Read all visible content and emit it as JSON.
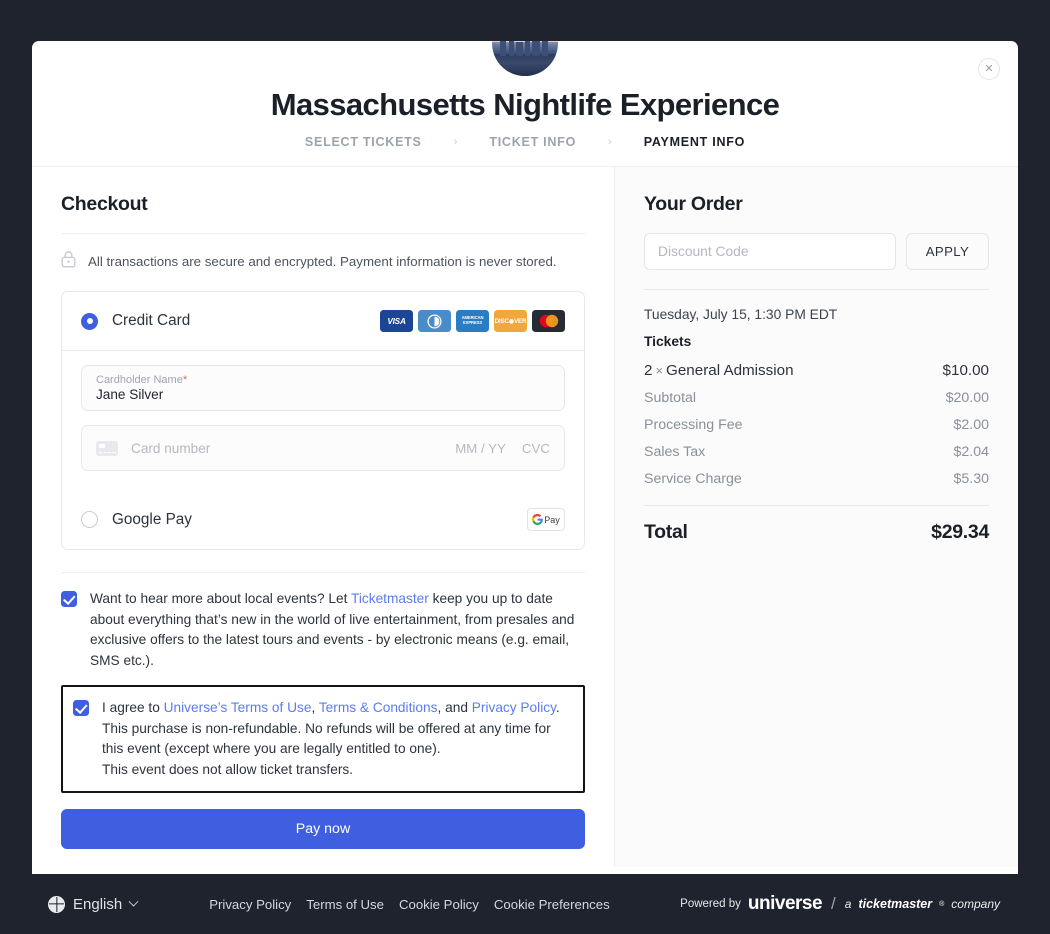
{
  "event": {
    "title": "Massachusetts Nightlife Experience",
    "avatar_icon": "event-thumbnail-city-skyline",
    "close_icon": "close-icon",
    "steps": [
      {
        "label": "SELECT TICKETS",
        "active": false
      },
      {
        "label": "TICKET INFO",
        "active": false
      },
      {
        "label": "PAYMENT INFO",
        "active": true
      }
    ],
    "step_separator": "›"
  },
  "checkout": {
    "title": "Checkout",
    "secure_notice": "All transactions are secure and encrypted. Payment information is never stored.",
    "lock_icon": "lock-icon",
    "methods": {
      "credit_card": {
        "label": "Credit Card",
        "selected": true,
        "brands": [
          {
            "name": "visa",
            "text": "VISA"
          },
          {
            "name": "diners-club",
            "text": ""
          },
          {
            "name": "american-express",
            "text": "AMERICAN EXPRESS"
          },
          {
            "name": "discover",
            "text": "DISC◉VER"
          },
          {
            "name": "mastercard",
            "text": ""
          }
        ]
      },
      "google_pay": {
        "label": "Google Pay",
        "selected": false,
        "badge_g": "G",
        "badge_pay": "Pay"
      }
    },
    "fields": {
      "cardholder": {
        "label": "Cardholder Name",
        "required_mark": "*",
        "value": "Jane Silver"
      },
      "card_number": {
        "placeholder": "Card number",
        "expiry_placeholder": "MM / YY",
        "cvc_placeholder": "CVC",
        "card_icon": "credit-card-icon"
      }
    },
    "consents": {
      "marketing": {
        "checked": true,
        "part1": "Want to hear more about local events? Let ",
        "link1": "Ticketmaster",
        "part2": " keep you up to date about everything that’s new in the world of live entertainment, from presales and exclusive offers to the latest tours and events - by electronic means (e.g. email, SMS etc.)."
      },
      "terms": {
        "checked": true,
        "part1": "I agree to ",
        "link1": "Universe’s Terms of Use",
        "sep1": ", ",
        "link2": "Terms & Conditions",
        "sep2": ", and ",
        "link3": "Privacy Policy",
        "part2": ". This purchase is non-refundable. No refunds will be offered at any time for this event (except where you are legally entitled to one).",
        "part3": "This event does not allow ticket transfers."
      }
    },
    "pay_button": "Pay now"
  },
  "order": {
    "title": "Your Order",
    "discount_placeholder": "Discount Code",
    "discount_value": "",
    "apply_label": "APPLY",
    "date": "Tuesday, July 15, 1:30 PM EDT",
    "tickets_heading": "Tickets",
    "ticket_items": [
      {
        "qty": "2",
        "x": "×",
        "name": "General Admission",
        "price": "$10.00"
      }
    ],
    "fees": [
      {
        "label": "Subtotal",
        "value": "$20.00"
      },
      {
        "label": "Processing Fee",
        "value": "$2.00"
      },
      {
        "label": "Sales Tax",
        "value": "$2.04"
      },
      {
        "label": "Service Charge",
        "value": "$5.30"
      }
    ],
    "total_label": "Total",
    "total_value": "$29.34"
  },
  "footer": {
    "language": "English",
    "globe_icon": "globe-icon",
    "chevron_icon": "chevron-down-icon",
    "links": [
      "Privacy Policy",
      "Terms of Use",
      "Cookie Policy",
      "Cookie Preferences"
    ],
    "powered_by": "Powered by",
    "brand": "universe",
    "divider": "/",
    "tagline_a": "a ",
    "tagline_tm": "ticketmaster",
    "tagline_sup": "®",
    "tagline_company": " company"
  },
  "colors": {
    "accent": "#3f5fe0",
    "link": "#5b7cf0",
    "backdrop": "#1f232d",
    "required": "#f0664a"
  }
}
